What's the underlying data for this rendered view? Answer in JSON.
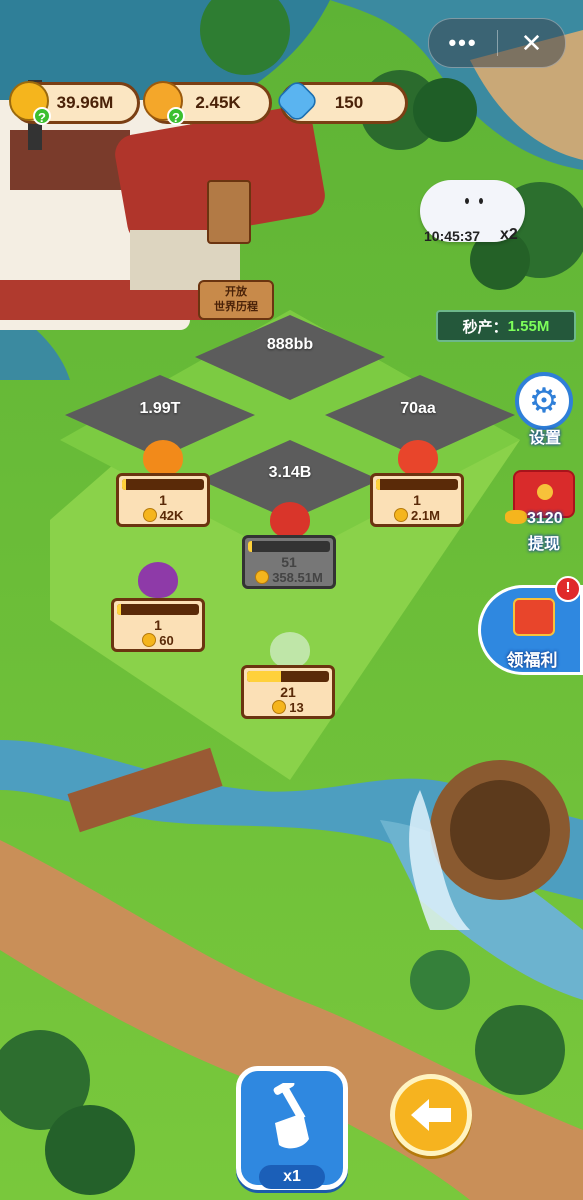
{
  "resources": {
    "coins": "39.96M",
    "hearts": "2.45K",
    "gems": "150"
  },
  "capsule": {
    "more_icon": "more-icon",
    "close_icon": "close-icon"
  },
  "cloud_timer": {
    "time": "10:45:37",
    "multiplier": "x2"
  },
  "production": {
    "label": "秒产：",
    "value": "1.55M"
  },
  "signpost": {
    "line1": "开放",
    "line2": "世界历程"
  },
  "plots": [
    {
      "label": "888bb"
    },
    {
      "label": "1.99T"
    },
    {
      "label": "70aa"
    },
    {
      "label": "3.14B"
    }
  ],
  "crops": [
    {
      "level": "1",
      "cost": "42K",
      "progress": 0.05
    },
    {
      "level": "1",
      "cost": "2.1M",
      "progress": 0.05
    },
    {
      "level": "51",
      "cost": "358.51M",
      "progress": 0.05
    },
    {
      "level": "1",
      "cost": "60",
      "progress": 0.05
    },
    {
      "level": "21",
      "cost": "13",
      "progress": 0.42
    }
  ],
  "side_buttons": {
    "settings_label": "设置",
    "withdraw_amount": "3120",
    "withdraw_label": "提现",
    "bonus_label": "领福利",
    "bonus_badge": "!"
  },
  "bottom": {
    "shovel_multiplier": "x1",
    "shovel_icon": "shovel-icon",
    "back_icon": "back-arrow-icon"
  }
}
